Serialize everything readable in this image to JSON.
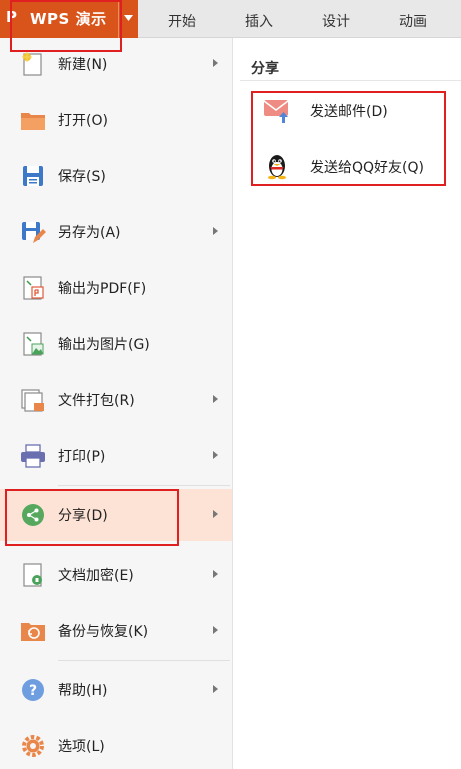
{
  "app": {
    "logo": "P",
    "title": "WPS 演示"
  },
  "tabs": [
    "开始",
    "插入",
    "设计",
    "动画"
  ],
  "menu": {
    "items": [
      {
        "label": "新建(N)",
        "icon": "new-file-icon",
        "submenu": true
      },
      {
        "label": "打开(O)",
        "icon": "folder-open-icon",
        "submenu": false
      },
      {
        "label": "保存(S)",
        "icon": "save-icon",
        "submenu": false
      },
      {
        "label": "另存为(A)",
        "icon": "save-as-icon",
        "submenu": true
      },
      {
        "label": "输出为PDF(F)",
        "icon": "pdf-export-icon",
        "submenu": false
      },
      {
        "label": "输出为图片(G)",
        "icon": "image-export-icon",
        "submenu": false
      },
      {
        "label": "文件打包(R)",
        "icon": "package-icon",
        "submenu": true
      },
      {
        "label": "打印(P)",
        "icon": "printer-icon",
        "submenu": true
      },
      {
        "label": "分享(D)",
        "icon": "share-icon",
        "submenu": true,
        "active": true
      },
      {
        "label": "文档加密(E)",
        "icon": "encrypt-icon",
        "submenu": true
      },
      {
        "label": "备份与恢复(K)",
        "icon": "backup-icon",
        "submenu": true
      },
      {
        "label": "帮助(H)",
        "icon": "help-icon",
        "submenu": true
      },
      {
        "label": "选项(L)",
        "icon": "gear-icon",
        "submenu": false
      }
    ]
  },
  "share_panel": {
    "title": "分享",
    "items": [
      {
        "label": "发送邮件(D)",
        "icon": "mail-icon"
      },
      {
        "label": "发送给QQ好友(Q)",
        "icon": "qq-penguin-icon"
      }
    ]
  },
  "colors": {
    "brand": "#d9541a",
    "active_bg": "#fde3d6",
    "annotation": "#e02020"
  }
}
